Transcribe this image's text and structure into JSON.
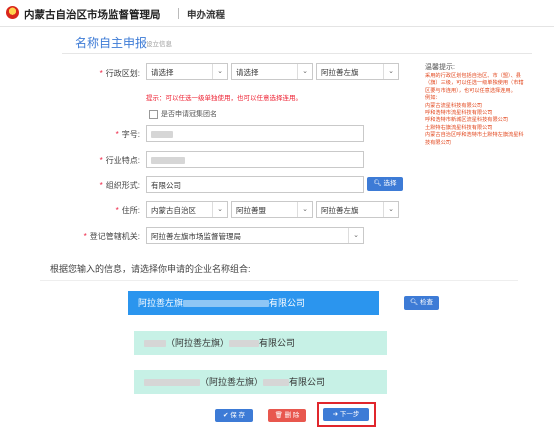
{
  "header": {
    "org": "内蒙古自治区市场监督管理局",
    "process": "申办流程"
  },
  "section": {
    "title": "名称自主申报",
    "subtitle": "设立信息"
  },
  "form": {
    "region_label": "行政区划:",
    "region_select_1": "请选择",
    "region_select_2": "请选择",
    "region_select_3": "阿拉善左旗",
    "region_hint": "提示：可以任选一级单独使用，也可以任意选择连用。",
    "group_checkbox_label": "是否申请冠集团名",
    "zihao_label": "字号:",
    "industry_label": "行业特点:",
    "org_form_label": "组织形式:",
    "org_form_value": "有限公司",
    "select_button": "选择",
    "domicile_label": "住所:",
    "domicile_1": "内蒙古自治区",
    "domicile_2": "阿拉善盟",
    "domicile_3": "阿拉善左旗",
    "authority_label": "登记管辖机关:",
    "authority_value": "阿拉善左旗市场监督管理局"
  },
  "tips": {
    "title": "温馨提示:",
    "lines": [
      "采用的行政区划包括自治区、市（盟）、县（旗）三级，可以任选一级单独使用（市辖区要与市连用），也可以任意选择连用。",
      "例如：",
      "内蒙古流星科技有限公司",
      "呼和浩特市流星科技有限公司",
      "呼和浩特市新城区流星科技有限公司",
      "土默特右旗流星科技有限公司",
      "内蒙古自治区呼和浩特市土默特左旗流星科技有限公司"
    ]
  },
  "combos": {
    "prompt": "根据您输入的信息，请选择你申请的企业名称组合:",
    "items": [
      {
        "prefix": "阿拉善左旗",
        "suffix": "有限公司"
      },
      {
        "prefix": "（阿拉善左旗）",
        "suffix": "有限公司"
      },
      {
        "prefix": "（阿拉善左旗）",
        "suffix": "有限公司"
      }
    ],
    "check_button": "检查"
  },
  "actions": {
    "save": "保 存",
    "delete": "删 除",
    "next": "下一步"
  },
  "colors": {
    "accent": "#3d7bd6",
    "required": "#e2461c",
    "active_combo": "#2b95ee",
    "combo_bg": "#c7f1e6",
    "save": "#3d7bd6",
    "delete": "#e8574e",
    "highlight": "#e0262c"
  }
}
